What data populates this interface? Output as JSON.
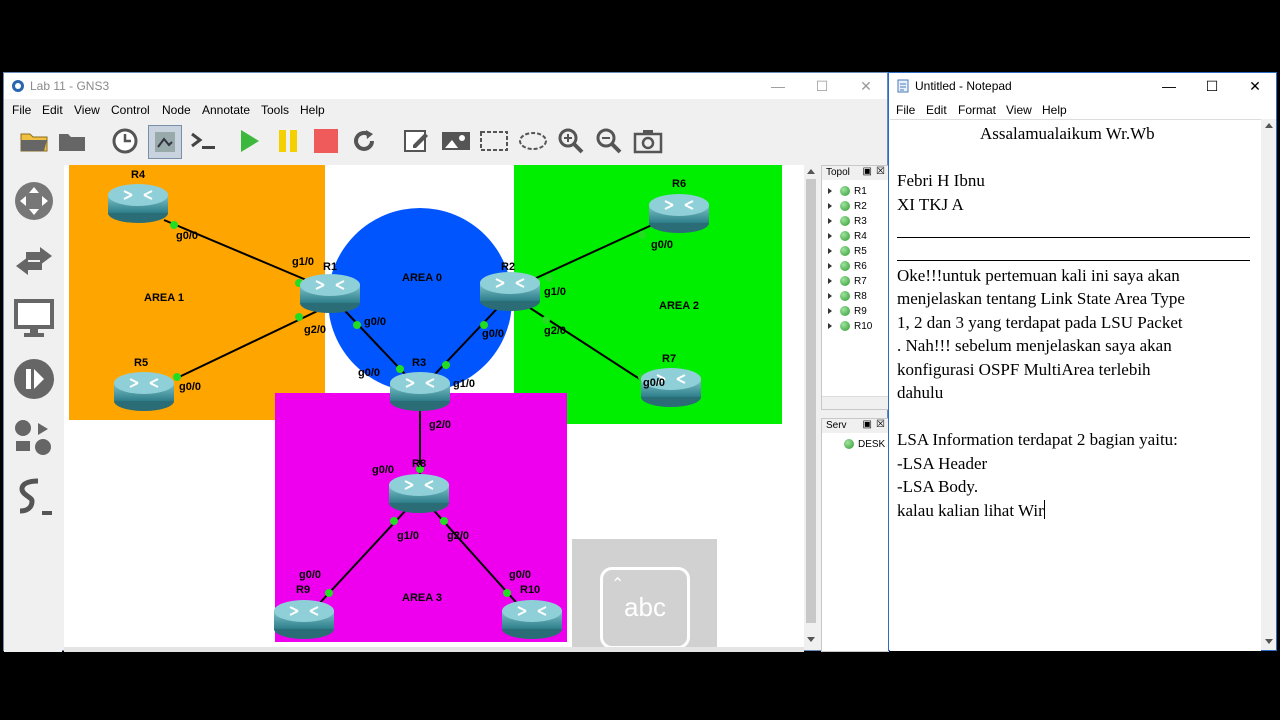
{
  "gns3": {
    "title": "Lab 11 - GNS3",
    "menu": [
      "File",
      "Edit",
      "View",
      "Control",
      "Node",
      "Annotate",
      "Tools",
      "Help"
    ],
    "toolbar_icons": [
      "folder-open-icon",
      "folder-icon",
      "clock-icon",
      "snapshot-icon",
      "console-icon",
      "start-icon",
      "pause-icon",
      "stop-icon",
      "reload-icon",
      "edit-note-icon",
      "image-icon",
      "rectangle-icon",
      "ellipse-icon",
      "zoom-in-icon",
      "zoom-out-icon",
      "camera-icon"
    ],
    "left_icons": [
      "routers-icon",
      "switches-icon",
      "end-devices-icon",
      "security-devices-icon",
      "all-devices-icon",
      "add-link-icon"
    ],
    "topology": {
      "areas": [
        {
          "label": "AREA 1",
          "color": "#FFA500"
        },
        {
          "label": "AREA 0",
          "color": "#0055FF"
        },
        {
          "label": "AREA 2",
          "color": "#00EE00"
        },
        {
          "label": "AREA 3",
          "color": "#EE00EE"
        }
      ],
      "routers": [
        "R1",
        "R2",
        "R3",
        "R4",
        "R5",
        "R6",
        "R7",
        "R8",
        "R9",
        "R10"
      ],
      "interfaces": {
        "r4_g0_0": "g0/0",
        "r1_g1_0": "g1/0",
        "r1_g2_0": "g2/0",
        "r1_g0_0": "g0/0",
        "r5_g0_0": "g0/0",
        "r2_g1_0": "g1/0",
        "r2_g2_0": "g2/0",
        "r2_g0_0": "g0/0",
        "r6_g0_0": "g0/0",
        "r7_g0_0": "g0/0",
        "r3_g0_0": "g0/0",
        "r3_g1_0": "g1/0",
        "r3_g2_0": "g2/0",
        "r8_g0_0": "g0/0",
        "r8_g1_0": "g1/0",
        "r8_g2_0": "g2/0",
        "r9_g0_0": "g0/0",
        "r10_g0_0": "g0/0"
      }
    },
    "topology_dock": {
      "title": "Topol",
      "items": [
        "R1",
        "R2",
        "R3",
        "R4",
        "R5",
        "R6",
        "R7",
        "R8",
        "R9",
        "R10"
      ]
    },
    "servers_dock": {
      "title": "Serv",
      "item": "DESK"
    },
    "overlay_text": "abc"
  },
  "notepad": {
    "title": "Untitled - Notepad",
    "menu": [
      "File",
      "Edit",
      "Format",
      "View",
      "Help"
    ],
    "lines": {
      "l1": "Assalamualaikum Wr.Wb",
      "l2": "Febri H Ibnu",
      "l3": "XI TKJ A",
      "l4": "Oke!!!untuk pertemuan kali ini saya akan",
      "l5": "menjelaskan tentang Link State Area Type",
      "l6": "1, 2 dan 3 yang terdapat pada LSU Packet",
      "l7": ". Nah!!! sebelum menjelaskan saya akan",
      "l8": "konfigurasi OSPF MultiArea terlebih",
      "l9": "dahulu",
      "l10": "LSA Information terdapat 2 bagian yaitu:",
      "l11": "-LSA Header",
      "l12": "-LSA Body.",
      "l13": "kalau kalian lihat Wir"
    }
  },
  "window_controls": {
    "minimize": "—",
    "maximize": "☐",
    "close": "✕"
  }
}
